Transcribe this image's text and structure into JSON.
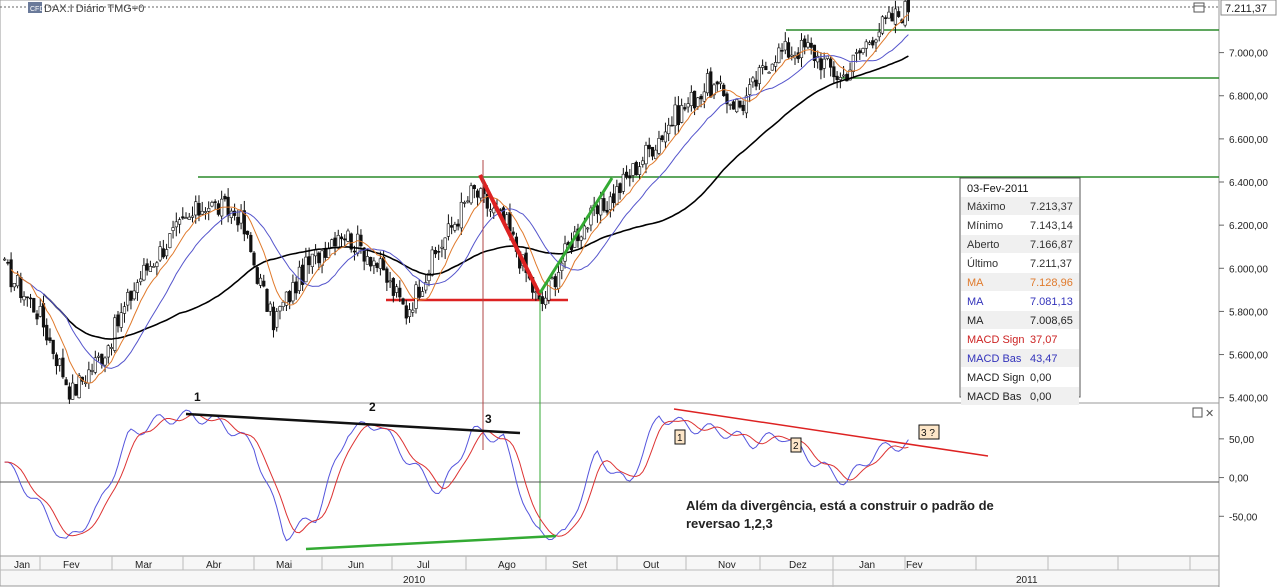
{
  "header": {
    "title": "DAX.I Diário TMG+0",
    "logo_text": "CFD",
    "last_price": "7.211,37"
  },
  "axes": {
    "price_ticks": [
      "7.000,00",
      "6.800,00",
      "6.600,00",
      "6.400,00",
      "6.200,00",
      "6.000,00",
      "5.800,00",
      "5.600,00",
      "5.400,00"
    ],
    "price_tick_values": [
      7000,
      6800,
      6600,
      6400,
      6200,
      6000,
      5800,
      5600,
      5400
    ],
    "macd_ticks": [
      "50,00",
      "0,00",
      "-50,00"
    ],
    "macd_tick_values": [
      50,
      0,
      -50
    ],
    "months": [
      "Jan",
      "Fev",
      "Mar",
      "Abr",
      "Mai",
      "Jun",
      "Jul",
      "Ago",
      "Set",
      "Out",
      "Nov",
      "Dez",
      "Jan",
      "Fev"
    ],
    "years": [
      "2010",
      "2011"
    ]
  },
  "info_box": {
    "date": "03-Fev-2011",
    "rows": [
      {
        "label": "Máximo",
        "value": "7.213,37",
        "color": "#333333"
      },
      {
        "label": "Mínimo",
        "value": "7.143,14",
        "color": "#333333"
      },
      {
        "label": "Aberto",
        "value": "7.166,87",
        "color": "#333333"
      },
      {
        "label": "Último",
        "value": "7.211,37",
        "color": "#333333"
      },
      {
        "label": "MA",
        "value": "7.128,96",
        "color": "#e07a2c"
      },
      {
        "label": "MA",
        "value": "7.081,13",
        "color": "#3333bb"
      },
      {
        "label": "MA",
        "value": "7.008,65",
        "color": "#222222"
      },
      {
        "label": "MACD Sign",
        "value": "37,07",
        "color": "#cc2222"
      },
      {
        "label": "MACD Bas",
        "value": "43,47",
        "color": "#3333bb"
      },
      {
        "label": "MACD Sign",
        "value": "0,00",
        "color": "#222222"
      },
      {
        "label": "MACD Bas",
        "value": "0,00",
        "color": "#222222"
      }
    ]
  },
  "annotations": {
    "pattern_labels_top": [
      "1",
      "2",
      "3"
    ],
    "pattern_labels_boxed": [
      "1",
      "2",
      "3 ?"
    ],
    "comment_line1": "Além da divergência, está a construir o padrão de",
    "comment_line2": "reversao 1,2,3"
  },
  "colors": {
    "candle": "#111111",
    "ma_fast": "#e07a2c",
    "ma_mid": "#5555cc",
    "ma_slow": "#000000",
    "macd_line": "#5555dd",
    "macd_signal": "#dd3333",
    "resistance": "#2a8a2a",
    "support": "#dd2222",
    "trend_up": "#33aa33",
    "trend_down": "#dd2222",
    "box_fill": "#fde6c8"
  },
  "chart_data": {
    "type": "candlestick",
    "title": "DAX.I Diário TMG+0",
    "period": "Jan 2010 – Fev 2011",
    "ylim_price": [
      5380,
      7230
    ],
    "ylim_macd": [
      -100,
      95
    ],
    "price_path": [
      {
        "month": "Jan",
        "value": 6000
      },
      {
        "month": "Jan",
        "value": 5800
      },
      {
        "month": "Fev",
        "value": 5420
      },
      {
        "month": "Fev",
        "value": 5620
      },
      {
        "month": "Mar",
        "value": 5950
      },
      {
        "month": "Mar",
        "value": 6150
      },
      {
        "month": "Abr",
        "value": 6300
      },
      {
        "month": "Abr",
        "value": 6250
      },
      {
        "month": "Mai",
        "value": 5750
      },
      {
        "month": "Mai",
        "value": 6000
      },
      {
        "month": "Jun",
        "value": 6180
      },
      {
        "month": "Jun",
        "value": 6050
      },
      {
        "month": "Jul",
        "value": 5800
      },
      {
        "month": "Jul",
        "value": 6100
      },
      {
        "month": "Jul",
        "value": 6360
      },
      {
        "month": "Ago",
        "value": 6200
      },
      {
        "month": "Ago",
        "value": 5820
      },
      {
        "month": "Set",
        "value": 6150
      },
      {
        "month": "Set",
        "value": 6300
      },
      {
        "month": "Out",
        "value": 6500
      },
      {
        "month": "Out",
        "value": 6700
      },
      {
        "month": "Nov",
        "value": 6850
      },
      {
        "month": "Nov",
        "value": 6750
      },
      {
        "month": "Dez",
        "value": 7000
      },
      {
        "month": "Dez",
        "value": 7020
      },
      {
        "month": "Jan",
        "value": 6880
      },
      {
        "month": "Jan",
        "value": 7100
      },
      {
        "month": "Fev",
        "value": 7211
      }
    ],
    "horizontal_levels": [
      6350,
      7080,
      6830,
      5795
    ],
    "macd_pivots": [
      {
        "label": "1",
        "value": 80
      },
      {
        "label": "2",
        "value": 70
      },
      {
        "label": "3",
        "value": 55
      }
    ]
  }
}
